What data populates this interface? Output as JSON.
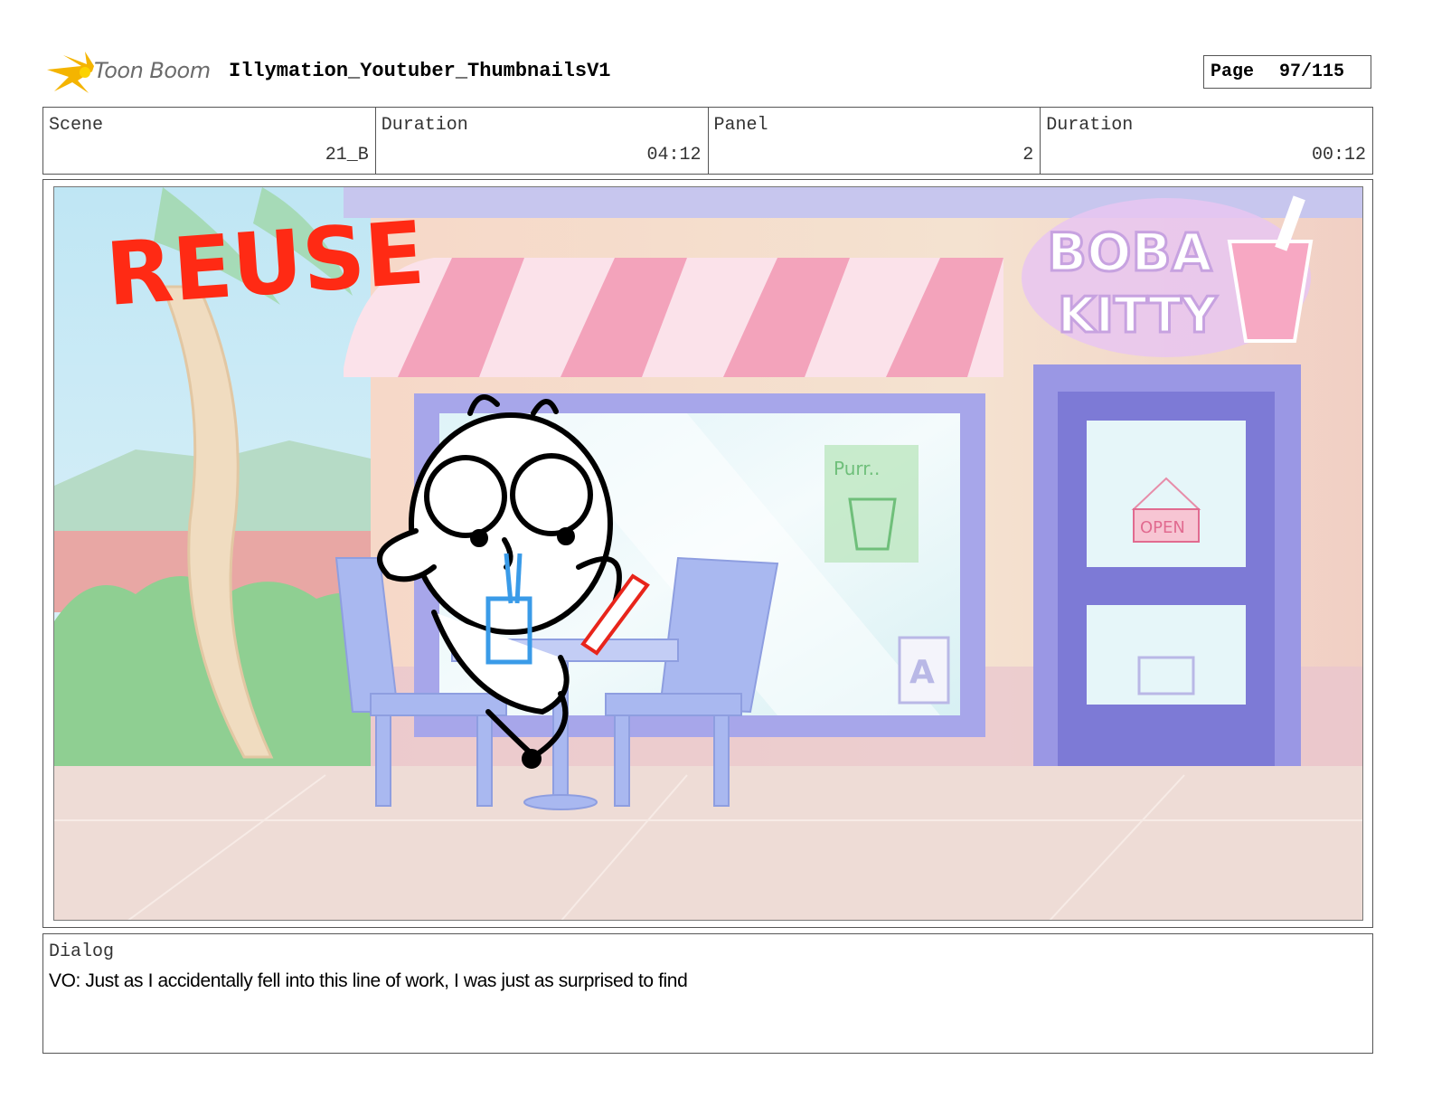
{
  "header": {
    "logo_text": "Toon Boom",
    "title": "Illymation_Youtuber_ThumbnailsV1",
    "page_label": "Page",
    "page_value": "97/115"
  },
  "info": {
    "scene_label": "Scene",
    "scene_value": "21_B",
    "scene_duration_label": "Duration",
    "scene_duration_value": "04:12",
    "panel_label": "Panel",
    "panel_value": "2",
    "panel_duration_label": "Duration",
    "panel_duration_value": "00:12"
  },
  "panel": {
    "reuse_text": "REUSE",
    "sign_line1": "BOBA",
    "sign_line2": "KITTY",
    "open_sign": "OPEN",
    "poster_text": "Purr.."
  },
  "dialog": {
    "label": "Dialog",
    "text": "VO: Just as I accidentally fell into this line of work, I was just as surprised to find"
  },
  "colors": {
    "reuse_red": "#ff2a14",
    "awning_pink": "#f08aa8",
    "store_purple": "#8f8fe0",
    "chair_blue": "#a9b8f0",
    "cup_blue": "#3a9be8"
  }
}
